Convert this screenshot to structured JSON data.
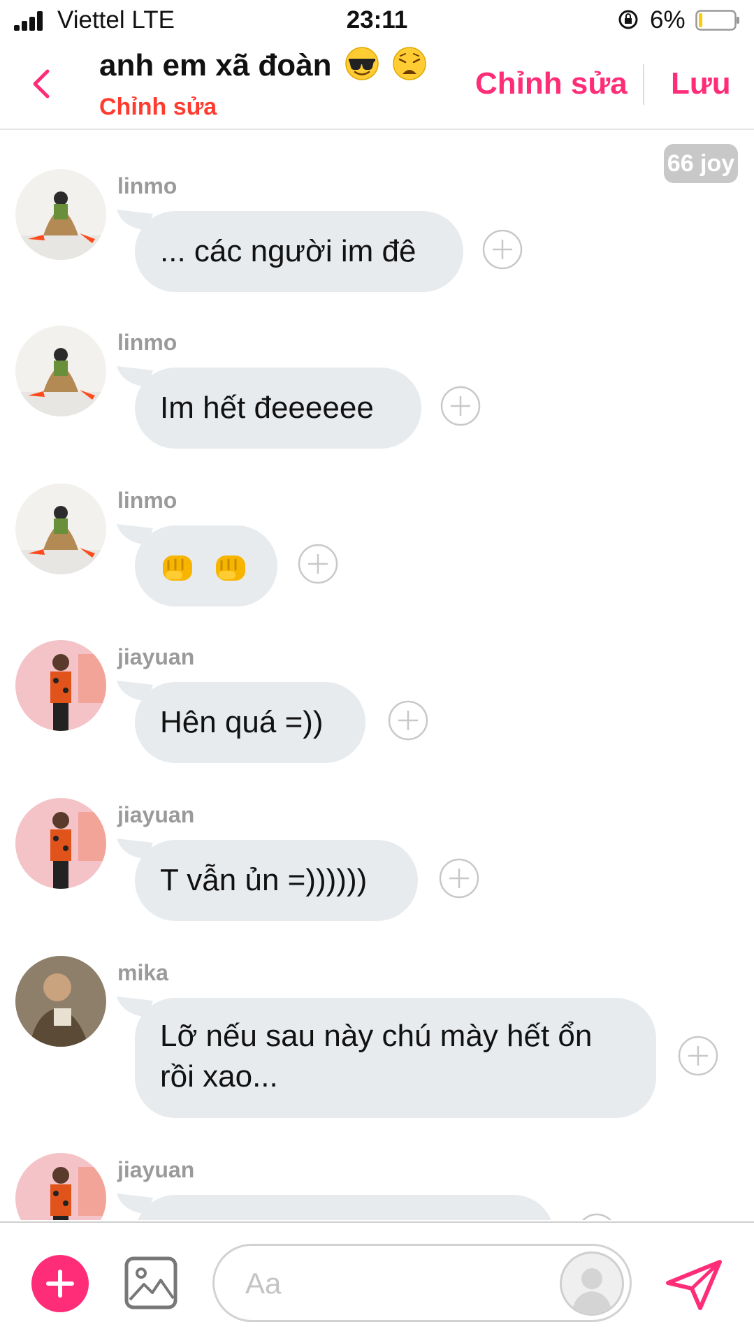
{
  "status_bar": {
    "carrier": "Viettel  LTE",
    "time": "23:11",
    "battery": "6%"
  },
  "header": {
    "title": "anh em xã đoàn",
    "title_emojis": [
      "smiling-face-with-sunglasses",
      "weary-face"
    ],
    "subtitle": "Chỉnh sửa",
    "edit_label": "Chỉnh sửa",
    "save_label": "Lưu"
  },
  "conversation": {
    "joy_badge": "66 joy",
    "messages": [
      {
        "sender": "linmo",
        "text": "... các người im đê"
      },
      {
        "sender": "linmo",
        "text": "Im hết đeeeeee"
      },
      {
        "sender": "linmo",
        "text": "",
        "emojis": [
          "oncoming-fist",
          "oncoming-fist"
        ]
      },
      {
        "sender": "jiayuan",
        "text": "Hên quá =))"
      },
      {
        "sender": "jiayuan",
        "text": "T vẫn ủn =))))))"
      },
      {
        "sender": "mika",
        "text": "Lỡ nếu sau này chú mày hết ổn rồi xao..."
      },
      {
        "sender": "jiayuan",
        "text": ""
      }
    ]
  },
  "composer": {
    "placeholder": "Aa",
    "icons": [
      "plus-icon",
      "image-icon",
      "avatar-sticker-icon",
      "send-icon"
    ]
  },
  "colors": {
    "accent": "#ff2d78",
    "subtitle_red": "#ff3b30",
    "bubble_bg": "#e8ebee",
    "sender_gray": "#9a9a9a"
  }
}
